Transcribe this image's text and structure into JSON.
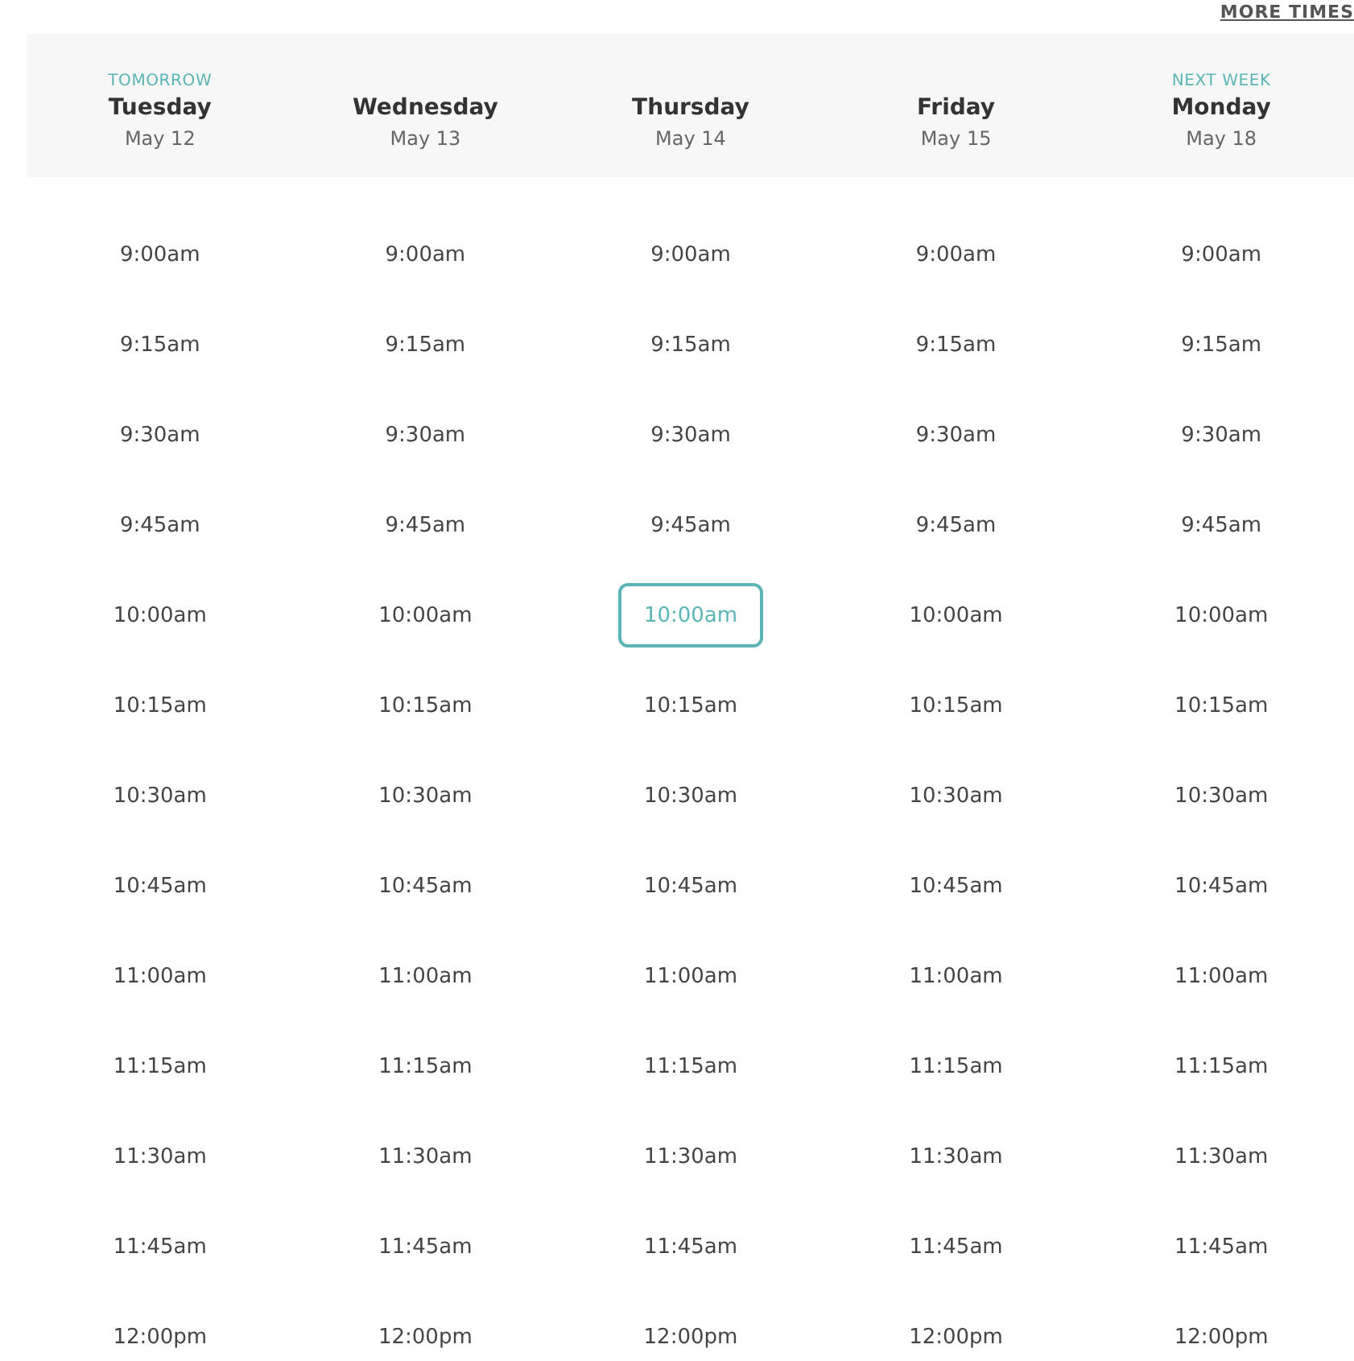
{
  "more_times_link": "MORE TIMES",
  "days": [
    {
      "tag": "TOMORROW",
      "day": "Tuesday",
      "date": "May 12",
      "slots": [
        {
          "time": "9:00am",
          "selected": false
        },
        {
          "time": "9:15am",
          "selected": false
        },
        {
          "time": "9:30am",
          "selected": false
        },
        {
          "time": "9:45am",
          "selected": false
        },
        {
          "time": "10:00am",
          "selected": false
        },
        {
          "time": "10:15am",
          "selected": false
        },
        {
          "time": "10:30am",
          "selected": false
        },
        {
          "time": "10:45am",
          "selected": false
        },
        {
          "time": "11:00am",
          "selected": false
        },
        {
          "time": "11:15am",
          "selected": false
        },
        {
          "time": "11:30am",
          "selected": false
        },
        {
          "time": "11:45am",
          "selected": false
        },
        {
          "time": "12:00pm",
          "selected": false
        }
      ]
    },
    {
      "day": "Wednesday",
      "date": "May 13",
      "slots": [
        {
          "time": "9:00am",
          "selected": false
        },
        {
          "time": "9:15am",
          "selected": false
        },
        {
          "time": "9:30am",
          "selected": false
        },
        {
          "time": "9:45am",
          "selected": false
        },
        {
          "time": "10:00am",
          "selected": false
        },
        {
          "time": "10:15am",
          "selected": false
        },
        {
          "time": "10:30am",
          "selected": false
        },
        {
          "time": "10:45am",
          "selected": false
        },
        {
          "time": "11:00am",
          "selected": false
        },
        {
          "time": "11:15am",
          "selected": false
        },
        {
          "time": "11:30am",
          "selected": false
        },
        {
          "time": "11:45am",
          "selected": false
        },
        {
          "time": "12:00pm",
          "selected": false
        }
      ]
    },
    {
      "day": "Thursday",
      "date": "May 14",
      "slots": [
        {
          "time": "9:00am",
          "selected": false
        },
        {
          "time": "9:15am",
          "selected": false
        },
        {
          "time": "9:30am",
          "selected": false
        },
        {
          "time": "9:45am",
          "selected": false
        },
        {
          "time": "10:00am",
          "selected": true
        },
        {
          "time": "10:15am",
          "selected": false
        },
        {
          "time": "10:30am",
          "selected": false
        },
        {
          "time": "10:45am",
          "selected": false
        },
        {
          "time": "11:00am",
          "selected": false
        },
        {
          "time": "11:15am",
          "selected": false
        },
        {
          "time": "11:30am",
          "selected": false
        },
        {
          "time": "11:45am",
          "selected": false
        },
        {
          "time": "12:00pm",
          "selected": false
        }
      ]
    },
    {
      "day": "Friday",
      "date": "May 15",
      "slots": [
        {
          "time": "9:00am",
          "selected": false
        },
        {
          "time": "9:15am",
          "selected": false
        },
        {
          "time": "9:30am",
          "selected": false
        },
        {
          "time": "9:45am",
          "selected": false
        },
        {
          "time": "10:00am",
          "selected": false
        },
        {
          "time": "10:15am",
          "selected": false
        },
        {
          "time": "10:30am",
          "selected": false
        },
        {
          "time": "10:45am",
          "selected": false
        },
        {
          "time": "11:00am",
          "selected": false
        },
        {
          "time": "11:15am",
          "selected": false
        },
        {
          "time": "11:30am",
          "selected": false
        },
        {
          "time": "11:45am",
          "selected": false
        },
        {
          "time": "12:00pm",
          "selected": false
        }
      ]
    },
    {
      "tag": "NEXT WEEK",
      "day": "Monday",
      "date": "May 18",
      "slots": [
        {
          "time": "9:00am",
          "selected": false
        },
        {
          "time": "9:15am",
          "selected": false
        },
        {
          "time": "9:30am",
          "selected": false
        },
        {
          "time": "9:45am",
          "selected": false
        },
        {
          "time": "10:00am",
          "selected": false
        },
        {
          "time": "10:15am",
          "selected": false
        },
        {
          "time": "10:30am",
          "selected": false
        },
        {
          "time": "10:45am",
          "selected": false
        },
        {
          "time": "11:00am",
          "selected": false
        },
        {
          "time": "11:15am",
          "selected": false
        },
        {
          "time": "11:30am",
          "selected": false
        },
        {
          "time": "11:45am",
          "selected": false
        },
        {
          "time": "12:00pm",
          "selected": false
        }
      ]
    }
  ]
}
